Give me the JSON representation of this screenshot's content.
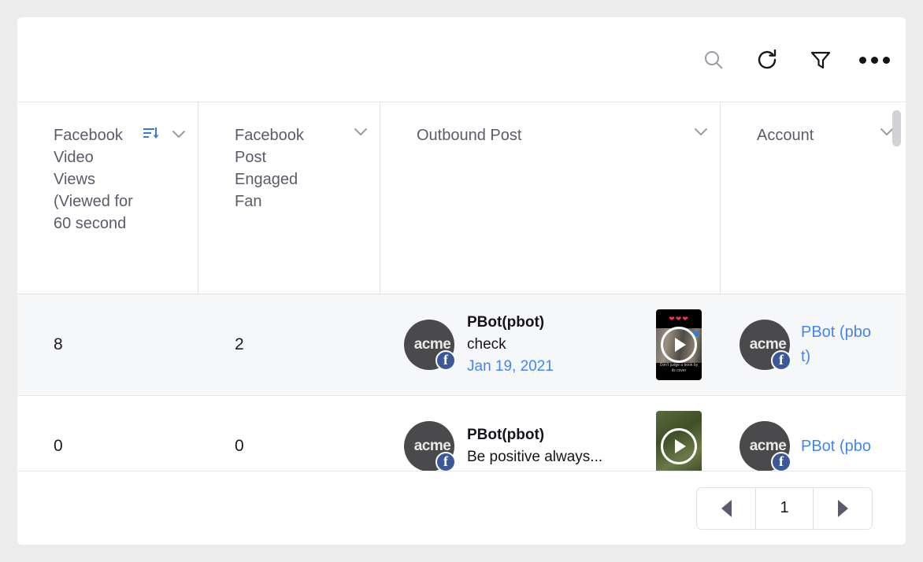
{
  "toolbar": {
    "search_label": "Search",
    "search_icon": "search-icon",
    "refresh_label": "Refresh",
    "refresh_icon": "refresh-icon",
    "filter_label": "Filter",
    "filter_icon": "filter-icon",
    "more_label": "More options",
    "more_icon": "more-options-icon"
  },
  "table": {
    "columns": [
      {
        "label": "Facebook Video Views (Viewed for 60 second",
        "sorted": true,
        "sort_icon": "sort-descending-icon",
        "menu_icon": "chevron-down-icon"
      },
      {
        "label": "Facebook Post Engaged Fan",
        "sorted": false,
        "menu_icon": "chevron-down-icon"
      },
      {
        "label": "Outbound Post",
        "sorted": false,
        "menu_icon": "chevron-down-icon"
      },
      {
        "label": "Account",
        "sorted": false,
        "menu_icon": "chevron-down-icon"
      }
    ],
    "rows": [
      {
        "video_views": "8",
        "engaged_fan": "2",
        "post": {
          "avatar_text": "acme",
          "network_badge": "facebook-badge",
          "author": "PBot(pbot)",
          "message": "check",
          "date": "Jan 19, 2021",
          "thumbnail": "video-thumbnail",
          "thumbnail_caption": "Don't judge a book by its cover",
          "play_icon": "play-icon"
        },
        "account": {
          "avatar_text": "acme",
          "network_badge": "facebook-badge",
          "name": "PBot (pbot)"
        },
        "highlighted": true
      },
      {
        "video_views": "0",
        "engaged_fan": "0",
        "post": {
          "avatar_text": "acme",
          "network_badge": "facebook-badge",
          "author": "PBot(pbot)",
          "message": "Be positive always...",
          "date": "",
          "thumbnail": "video-thumbnail",
          "thumbnail_caption": "",
          "play_icon": "play-icon"
        },
        "account": {
          "avatar_text": "acme",
          "network_badge": "facebook-badge",
          "name": "PBot (pbo"
        },
        "highlighted": false
      }
    ]
  },
  "pagination": {
    "prev_label": "Previous page",
    "prev_icon": "triangle-left-icon",
    "page": "1",
    "next_label": "Next page",
    "next_icon": "triangle-right-icon"
  },
  "colors": {
    "link": "#4285f4",
    "sort_active": "#3b78e7",
    "header_text": "#5b5b6b",
    "row_highlight": "#f6f7f9",
    "facebook": "#3b5998"
  }
}
